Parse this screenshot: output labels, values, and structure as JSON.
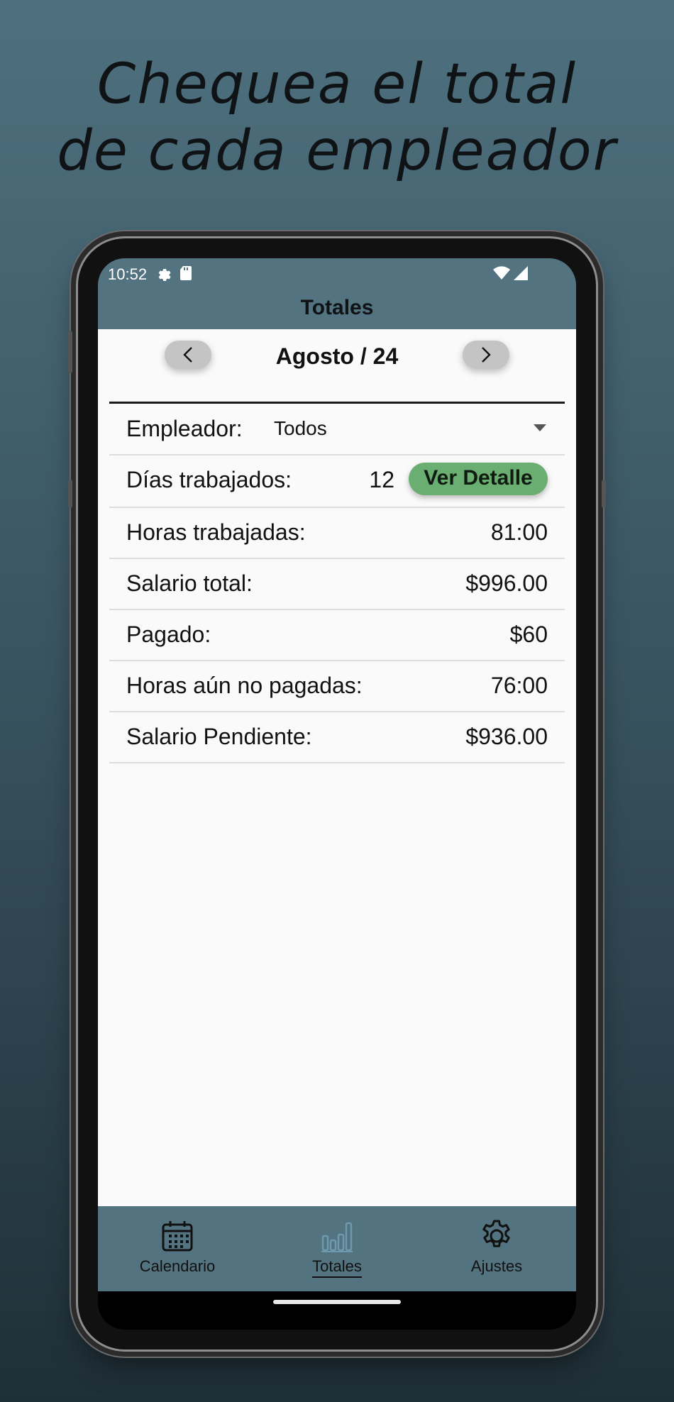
{
  "headline": {
    "line1": "Chequea el total",
    "line2": "de cada empleador"
  },
  "status_bar": {
    "time": "10:52",
    "icons": [
      "gear-icon",
      "sd-card-icon",
      "wifi-icon",
      "signal-icon"
    ]
  },
  "app_bar": {
    "title": "Totales"
  },
  "month_nav": {
    "label": "Agosto / 24",
    "prev_icon": "chevron-left-icon",
    "next_icon": "chevron-right-icon"
  },
  "employer": {
    "label": "Empleador:",
    "selected": "Todos"
  },
  "summary": {
    "days_label": "Días trabajados:",
    "days_value": "12",
    "detail_button": "Ver Detalle",
    "hours_label": "Horas trabajadas:",
    "hours_value": "81:00",
    "salary_label": "Salario total:",
    "salary_value": "$996.00",
    "paid_label": "Pagado:",
    "paid_value": "$60",
    "unpaid_hours_label": "Horas aún no pagadas:",
    "unpaid_hours_value": "76:00",
    "pending_label": "Salario Pendiente:",
    "pending_value": "$936.00"
  },
  "bottom_nav": {
    "calendar": "Calendario",
    "totals": "Totales",
    "settings": "Ajustes",
    "active": "Totales"
  },
  "colors": {
    "bar": "#52737f",
    "accent_green": "#6aae72",
    "active_icon": "#6f9aad"
  }
}
